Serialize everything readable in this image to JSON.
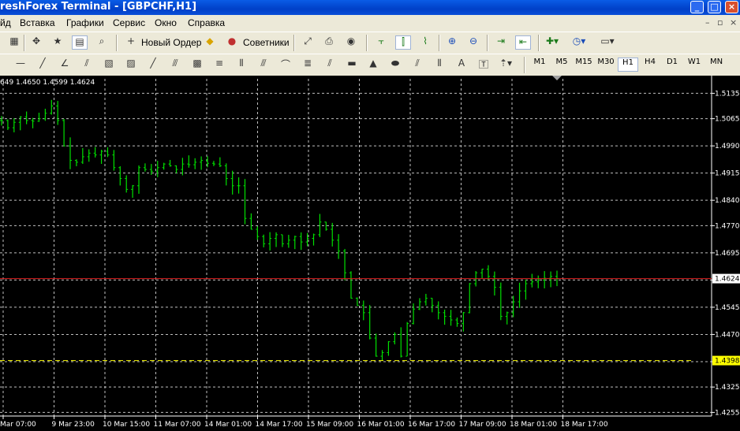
{
  "window": {
    "title": "reshForex Terminal - [GBPCHF,H1]"
  },
  "menu": {
    "items": [
      "йд",
      "Вставка",
      "Графики",
      "Сервис",
      "Окно",
      "Справка"
    ]
  },
  "toolbar": {
    "new_order_label": "Новый Ордер",
    "experts_label": "Советники"
  },
  "timeframes": {
    "items": [
      "M1",
      "M5",
      "M15",
      "M30",
      "H1",
      "H4",
      "D1",
      "W1",
      "MN"
    ],
    "selected": "H1"
  },
  "chart": {
    "ohlc_text": "649 1.4650 1.4599 1.4624",
    "bid_label": "1.4624",
    "level_label": "1.4398"
  },
  "chart_data": {
    "type": "bar",
    "symbol": "GBPCHF",
    "timeframe": "H1",
    "ylim": [
      1.4245,
      1.5175
    ],
    "y_ticks": [
      "1.5135",
      "1.5065",
      "1.4990",
      "1.4915",
      "1.4840",
      "1.4770",
      "1.4695",
      "1.4620",
      "1.4545",
      "1.4470",
      "1.4395",
      "1.4325",
      "1.4255"
    ],
    "x_ticks": [
      "Mar 07:00",
      "9 Mar 23:00",
      "10 Mar 15:00",
      "11 Mar 07:00",
      "14 Mar 01:00",
      "14 Mar 17:00",
      "15 Mar 09:00",
      "16 Mar 01:00",
      "16 Mar 17:00",
      "17 Mar 09:00",
      "18 Mar 01:00",
      "18 Mar 17:00"
    ],
    "bid": 1.4624,
    "level": 1.4398,
    "close": [
      1.506,
      1.504,
      1.5055,
      1.507,
      1.506,
      1.5058,
      1.5065,
      1.508,
      1.51,
      1.506,
      1.499,
      1.495,
      1.4945,
      1.496,
      1.497,
      1.4965,
      1.4975,
      1.4965,
      1.493,
      1.49,
      1.487,
      1.488,
      1.493,
      1.4925,
      1.492,
      1.493,
      1.494,
      1.4935,
      1.4925,
      1.494,
      1.4938,
      1.4945,
      1.495,
      1.4942,
      1.494,
      1.4935,
      1.49,
      1.488,
      1.488,
      1.479,
      1.476,
      1.474,
      1.472,
      1.4735,
      1.4745,
      1.472,
      1.473,
      1.474,
      1.4725,
      1.4735,
      1.4745,
      1.478,
      1.476,
      1.473,
      1.47,
      1.464,
      1.457,
      1.455,
      1.453,
      1.446,
      1.441,
      1.442,
      1.445,
      1.447,
      1.441,
      1.45,
      1.454,
      1.456,
      1.457,
      1.455,
      1.453,
      1.452,
      1.451,
      1.45,
      1.453,
      1.461,
      1.464,
      1.465,
      1.463,
      1.46,
      1.452,
      1.453,
      1.456,
      1.459,
      1.461,
      1.4615,
      1.462,
      1.4625,
      1.463,
      1.4624
    ]
  }
}
